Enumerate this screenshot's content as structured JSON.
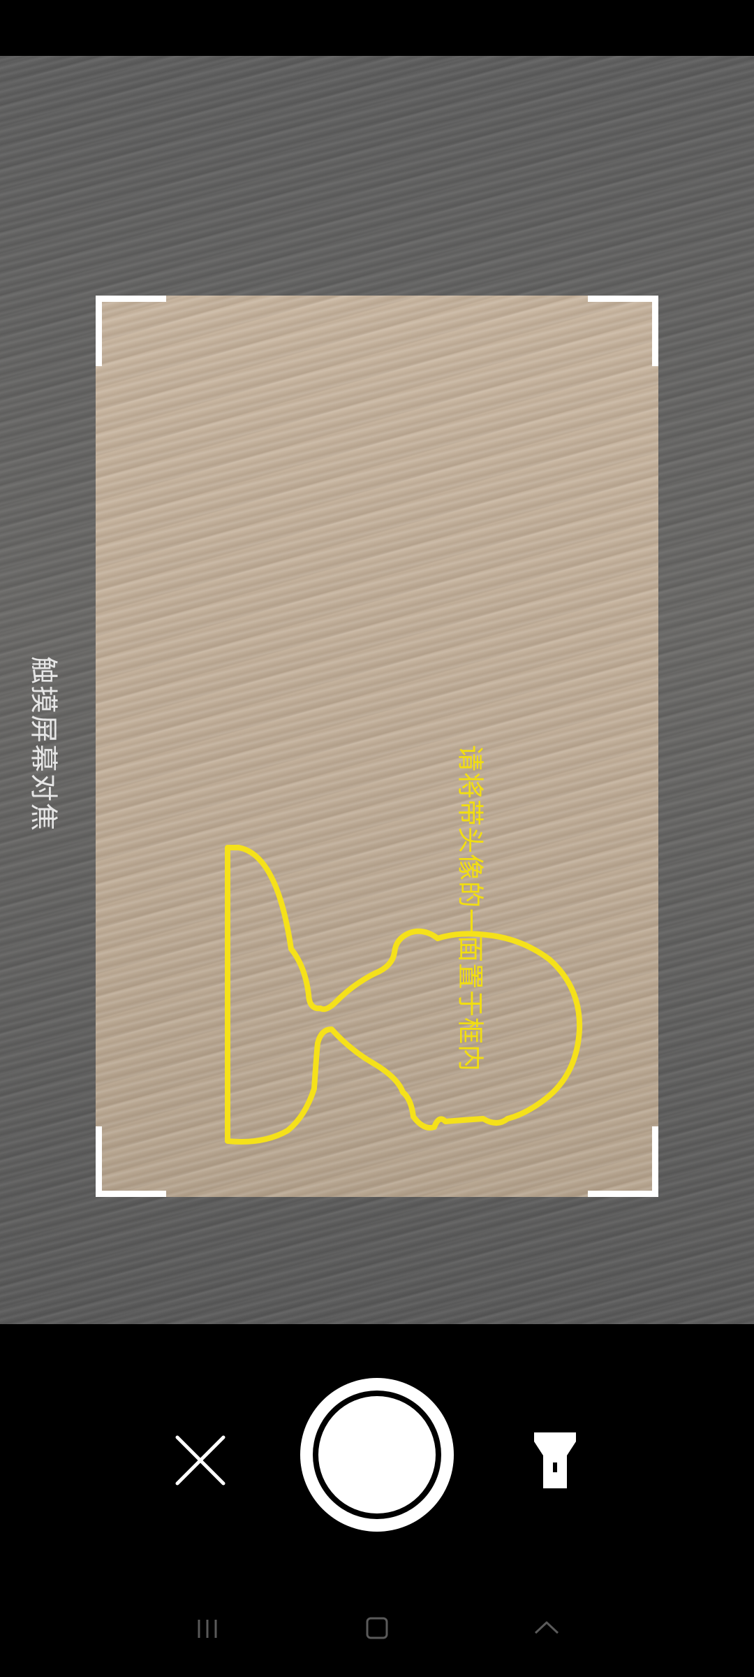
{
  "viewfinder": {
    "focus_hint": "触摸屏幕对焦"
  },
  "scan_frame": {
    "instruction": "请将带头像的一面置于框内",
    "guide_color": "#f5e11a",
    "corner_color": "#ffffff"
  },
  "controls": {
    "close_icon": "close-icon",
    "shutter_icon": "shutter-icon",
    "flashlight_icon": "flashlight-icon"
  },
  "navigation": {
    "recent_icon": "recent-apps-icon",
    "home_icon": "home-icon",
    "back_icon": "back-icon"
  }
}
